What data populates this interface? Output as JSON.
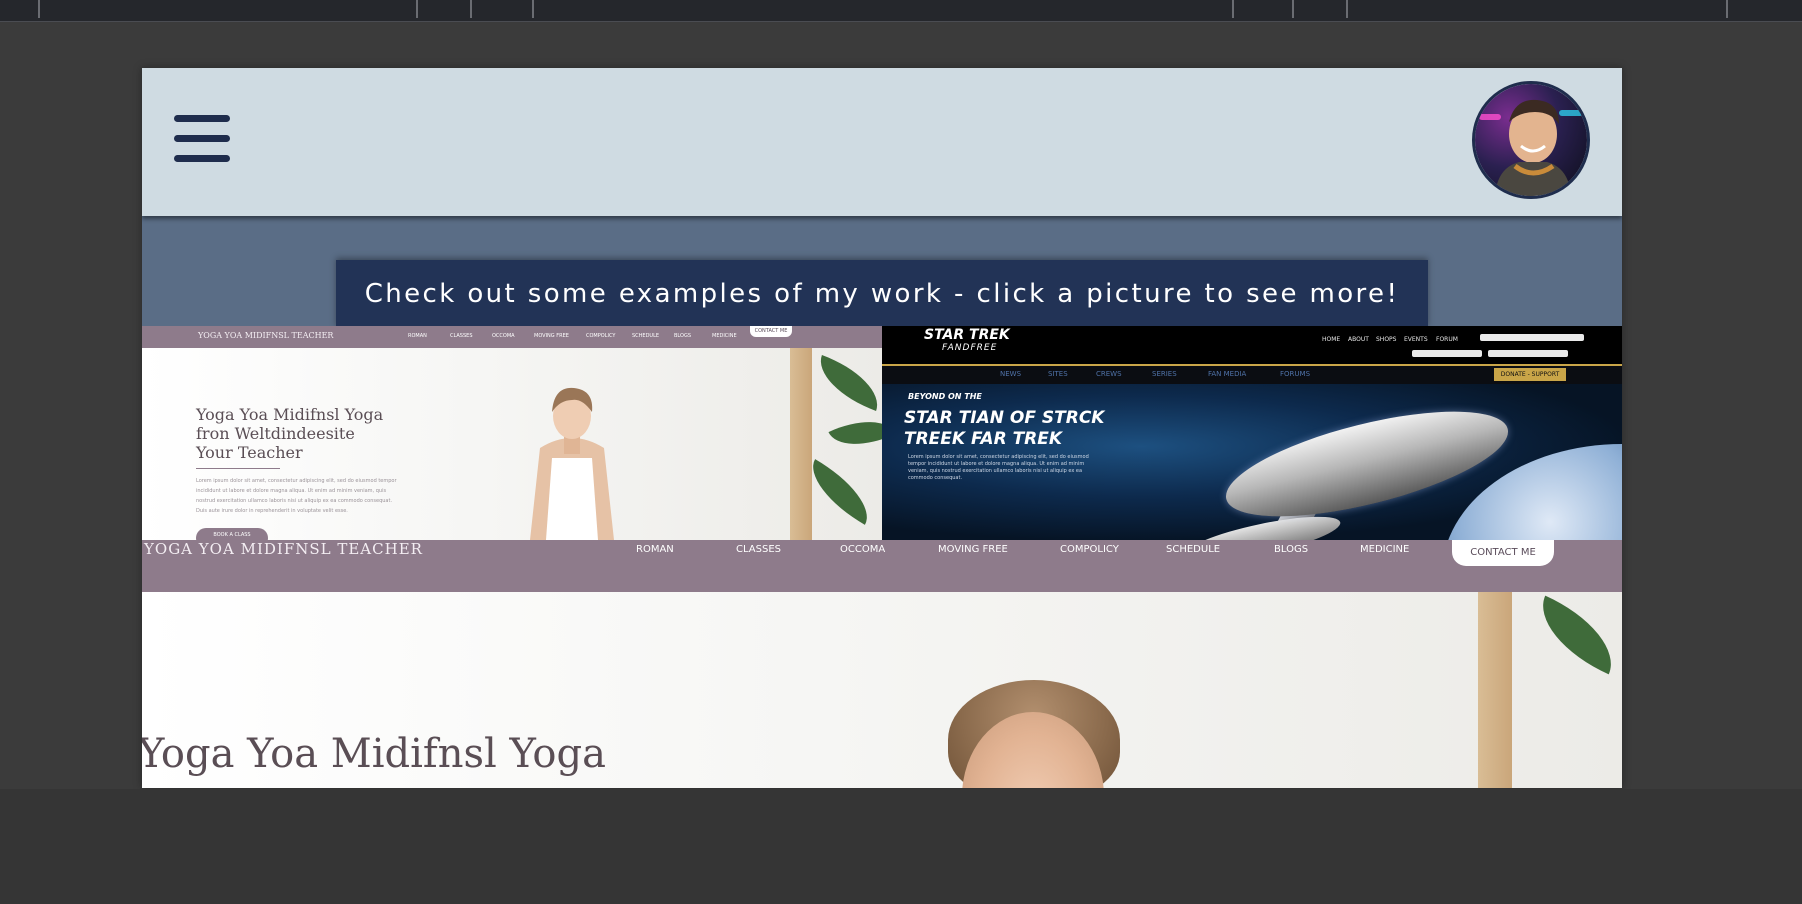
{
  "header": {
    "menu_icon": "hamburger-menu-icon",
    "avatar_icon": "profile-photo-avatar"
  },
  "banner": {
    "title": "Check out some examples of my work - click a picture to see more!"
  },
  "yoga_site": {
    "brand": "YOGA YOA MIDIFNSL TEACHER",
    "nav_items": [
      "ROMAN",
      "CLASSES",
      "OCCOMA",
      "MOVING FREE",
      "COMPOLICY",
      "SCHEDULE",
      "BLOGS",
      "MEDICINE"
    ],
    "cta": "CONTACT ME",
    "title_lines": [
      "Yoga Yoa Midifnsl Yoga",
      "fron Weltdindeesite",
      "Your Teacher"
    ],
    "body_lines": [
      "Lorem ipsum dolor sit amet, consectetur adipiscing elit, sed do eiusmod tempor",
      "incididunt ut labore et dolore magna aliqua. Ut enim ad minim veniam, quis",
      "nostrud exercitation ullamco laboris nisi ut aliquip ex ea commodo consequat.",
      "Duis aute irure dolor in reprehenderit in voluptate velit esse."
    ],
    "button": "BOOK A CLASS"
  },
  "trek_site": {
    "brand": "STAR TREK",
    "subbrand": "FANDFREE",
    "top_links": [
      "HOME",
      "ABOUT",
      "SHOPS",
      "EVENTS",
      "FORUM"
    ],
    "nav_items": [
      "NEWS",
      "SITES",
      "CREWS",
      "SERIES",
      "FAN MEDIA",
      "FORUMS"
    ],
    "donate": "DONATE - SUPPORT",
    "kicker": "BEYOND ON THE",
    "title": "STAR TIAN OF STRCK\nTREEK FAR TREK",
    "body": "Lorem ipsum dolor sit amet, consectetur adipiscing elit, sed do eiusmod tempor incididunt ut labore et dolore magna aliqua. Ut enim ad minim veniam, quis nostrud exercitation ullamco laboris nisi ut aliquip ex ea commodo consequat."
  },
  "hero": {
    "title": "Yoga Yoa Midifnsl Yoga"
  },
  "colors": {
    "header_bg": "#cfdbe2",
    "navy": "#223356",
    "banner_bg": "#5a6d86",
    "yoga_mauve": "#8e7b8b",
    "trek_gold": "#c9a548"
  }
}
